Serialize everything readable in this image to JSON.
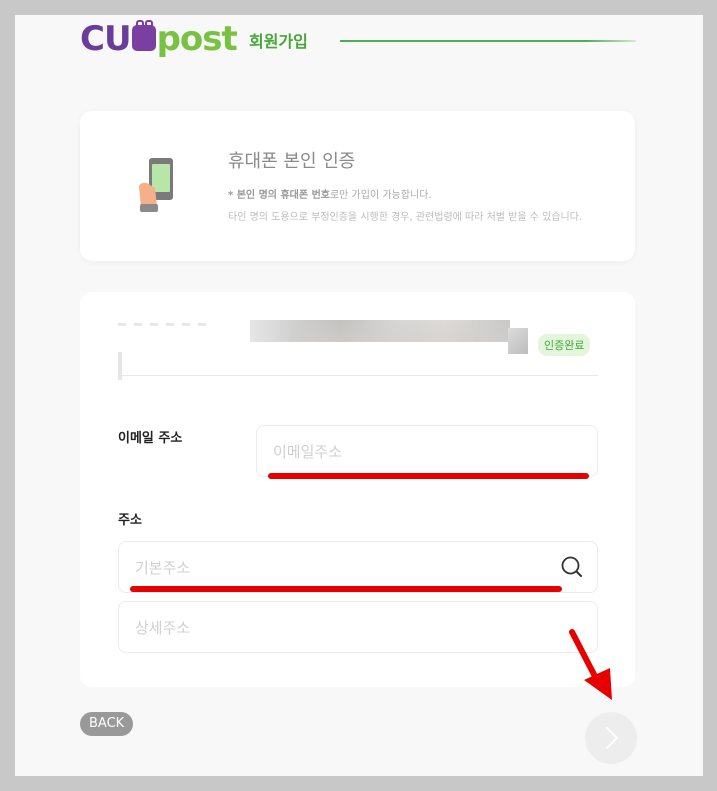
{
  "header": {
    "logo_text": "CUpost",
    "logo_cu": "CU",
    "logo_post": "post",
    "title": "회원가입"
  },
  "info_card": {
    "title": "휴대폰 본인 인증",
    "line1_bullet": "* ",
    "line1_bold1": "본인 명의 휴대폰 번호",
    "line1_rest": "로만 가입이 가능합니다.",
    "line2": "타인 명의 도용으로 부정인증을 시행한 경우, 관련법령에 따라 처벌 받을 수 있습니다."
  },
  "form": {
    "verified_badge": "인증완료",
    "email_label": "이메일 주소",
    "email_placeholder": "이메일주소",
    "address_label": "주소",
    "address_placeholder": "기본주소",
    "detail_placeholder": "상세주소"
  },
  "footer": {
    "back_label": "BACK"
  },
  "colors": {
    "brand_purple": "#6a3d9a",
    "brand_green": "#79c142",
    "accent_green": "#45a836",
    "annotation_red": "#e60000"
  },
  "icons": {
    "phone": "phone-verify-icon",
    "search": "search-icon",
    "next": "chevron-right-icon",
    "arrow": "annotation-arrow"
  }
}
